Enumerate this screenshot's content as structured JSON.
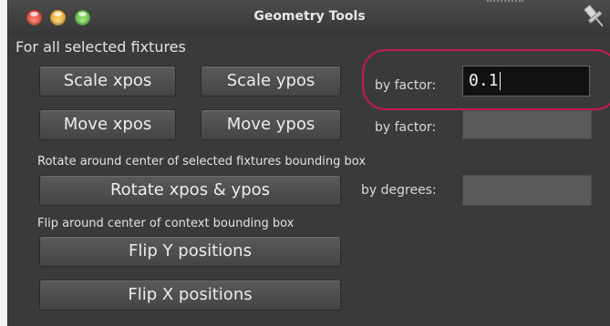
{
  "window": {
    "title": "Geometry Tools"
  },
  "section1": {
    "label": "For all selected fixtures",
    "scale_xpos": "Scale xpos",
    "scale_ypos": "Scale ypos",
    "scale_factor_label": "by factor:",
    "scale_factor_value": "0.1",
    "move_xpos": "Move xpos",
    "move_ypos": "Move ypos",
    "move_factor_label": "by factor:",
    "move_factor_value": ""
  },
  "section2": {
    "label": "Rotate around center of selected fixtures bounding box",
    "rotate_button": "Rotate xpos & ypos",
    "degrees_label": "by degrees:",
    "degrees_value": ""
  },
  "section3": {
    "label": "Flip around center of context bounding box",
    "flip_y": "Flip Y positions",
    "flip_x": "Flip X positions"
  },
  "colors": {
    "window_bg": "#3a3a3a",
    "highlight": "#c51a4d"
  },
  "icons": [
    "close-light-icon",
    "minimize-light-icon",
    "zoom-light-icon",
    "pin-icon"
  ]
}
